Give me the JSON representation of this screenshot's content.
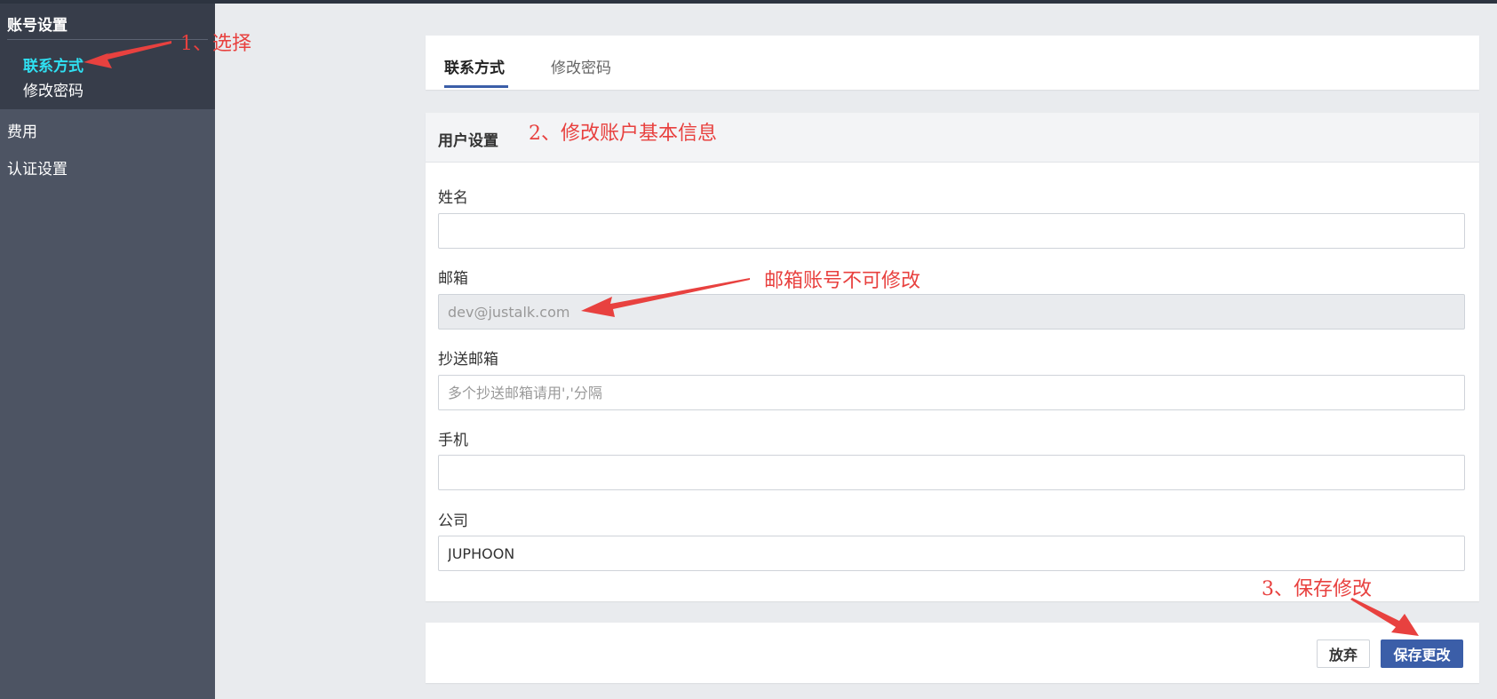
{
  "sidebar": {
    "group_title": "账号设置",
    "sub_items": [
      {
        "label": "联系方式",
        "active": true
      },
      {
        "label": "修改密码",
        "active": false
      }
    ],
    "items": [
      {
        "label": "费用"
      },
      {
        "label": "认证设置"
      }
    ]
  },
  "tabs": [
    {
      "label": "联系方式",
      "active": true
    },
    {
      "label": "修改密码",
      "active": false
    }
  ],
  "form": {
    "header_title": "用户设置",
    "name": {
      "label": "姓名",
      "value": "",
      "placeholder": ""
    },
    "email": {
      "label": "邮箱",
      "value": "dev@justalk.com",
      "placeholder": ""
    },
    "cc_email": {
      "label": "抄送邮箱",
      "value": "",
      "placeholder": "多个抄送邮箱请用','分隔"
    },
    "phone": {
      "label": "手机",
      "value": "",
      "placeholder": ""
    },
    "company": {
      "label": "公司",
      "value": "JUPHOON",
      "placeholder": ""
    }
  },
  "actions": {
    "discard_label": "放弃",
    "save_label": "保存更改"
  },
  "annotations": {
    "step1": "1、选择",
    "step2": "2、修改账户基本信息",
    "email_note": "邮箱账号不可修改",
    "step3": "3、保存修改"
  },
  "colors": {
    "accent": "#3b5ea8",
    "active_sidebar": "#2fe0f2",
    "annotation": "#e8413f",
    "sidebar_bg": "#4d5463",
    "sidebar_group_bg": "#373d4a"
  }
}
